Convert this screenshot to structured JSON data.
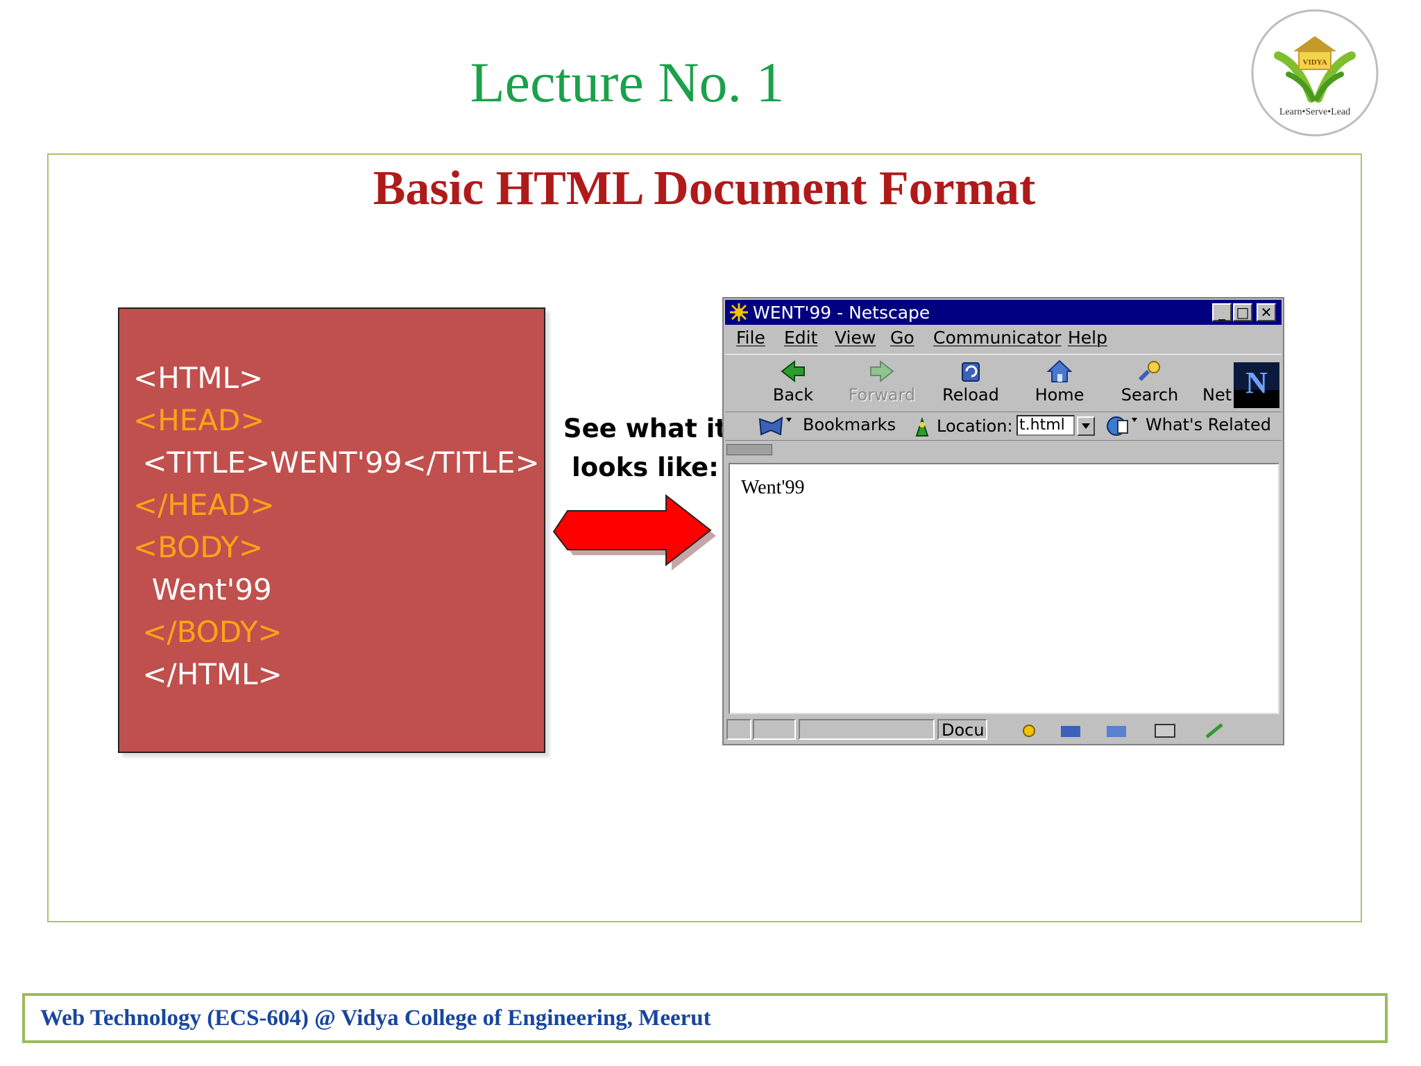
{
  "header": {
    "lecture_title": "Lecture No. 1",
    "logo": {
      "name_text": "VIDYA",
      "tagline": "Learn•Serve•Lead"
    }
  },
  "slide": {
    "heading": "Basic HTML Document Format",
    "code_lines": [
      {
        "text": "<HTML>",
        "color": "#ffffff"
      },
      {
        "text": "<HEAD>",
        "color": "#ffa319"
      },
      {
        "text": " <TITLE>WENT'99</TITLE>",
        "color": "#ffffff"
      },
      {
        "text": "</HEAD>",
        "color": "#ffa319"
      },
      {
        "text": "<BODY>",
        "color": "#ffa319"
      },
      {
        "text": "  Went'99",
        "color": "#ffffff"
      },
      {
        "text": " </BODY>",
        "color": "#ffa319"
      },
      {
        "text": " </HTML>",
        "color": "#ffffff"
      }
    ],
    "caption_line1": "See what it",
    "caption_line2": "looks like:"
  },
  "browser": {
    "title": "WENT'99 - Netscape",
    "menu": [
      "File",
      "Edit",
      "View",
      "Go",
      "Communicator",
      "Help"
    ],
    "toolbar": [
      {
        "label": "Back",
        "icon": "back-arrow-icon",
        "enabled": true
      },
      {
        "label": "Forward",
        "icon": "forward-arrow-icon",
        "enabled": false
      },
      {
        "label": "Reload",
        "icon": "reload-icon",
        "enabled": true
      },
      {
        "label": "Home",
        "icon": "home-icon",
        "enabled": true
      },
      {
        "label": "Search",
        "icon": "search-icon",
        "enabled": true
      },
      {
        "label": "Net",
        "icon": "netscape-icon",
        "enabled": true
      }
    ],
    "bookmarks_label": "Bookmarks",
    "location_label": "Location:",
    "location_value": "t.html",
    "whats_related_label": "What's Related",
    "page_text": "Went'99",
    "status_text": "Docur"
  },
  "footer": {
    "text": "Web Technology (ECS-604) @ Vidya College of Engineering, Meerut"
  },
  "colors": {
    "title_green": "#1aa14a",
    "heading_red": "#b01a1a",
    "code_box": "#c0504d",
    "code_orange": "#ffa319",
    "footer_blue": "#17469e",
    "frame_green": "#9bbb59",
    "arrow_red": "#ff0000"
  }
}
